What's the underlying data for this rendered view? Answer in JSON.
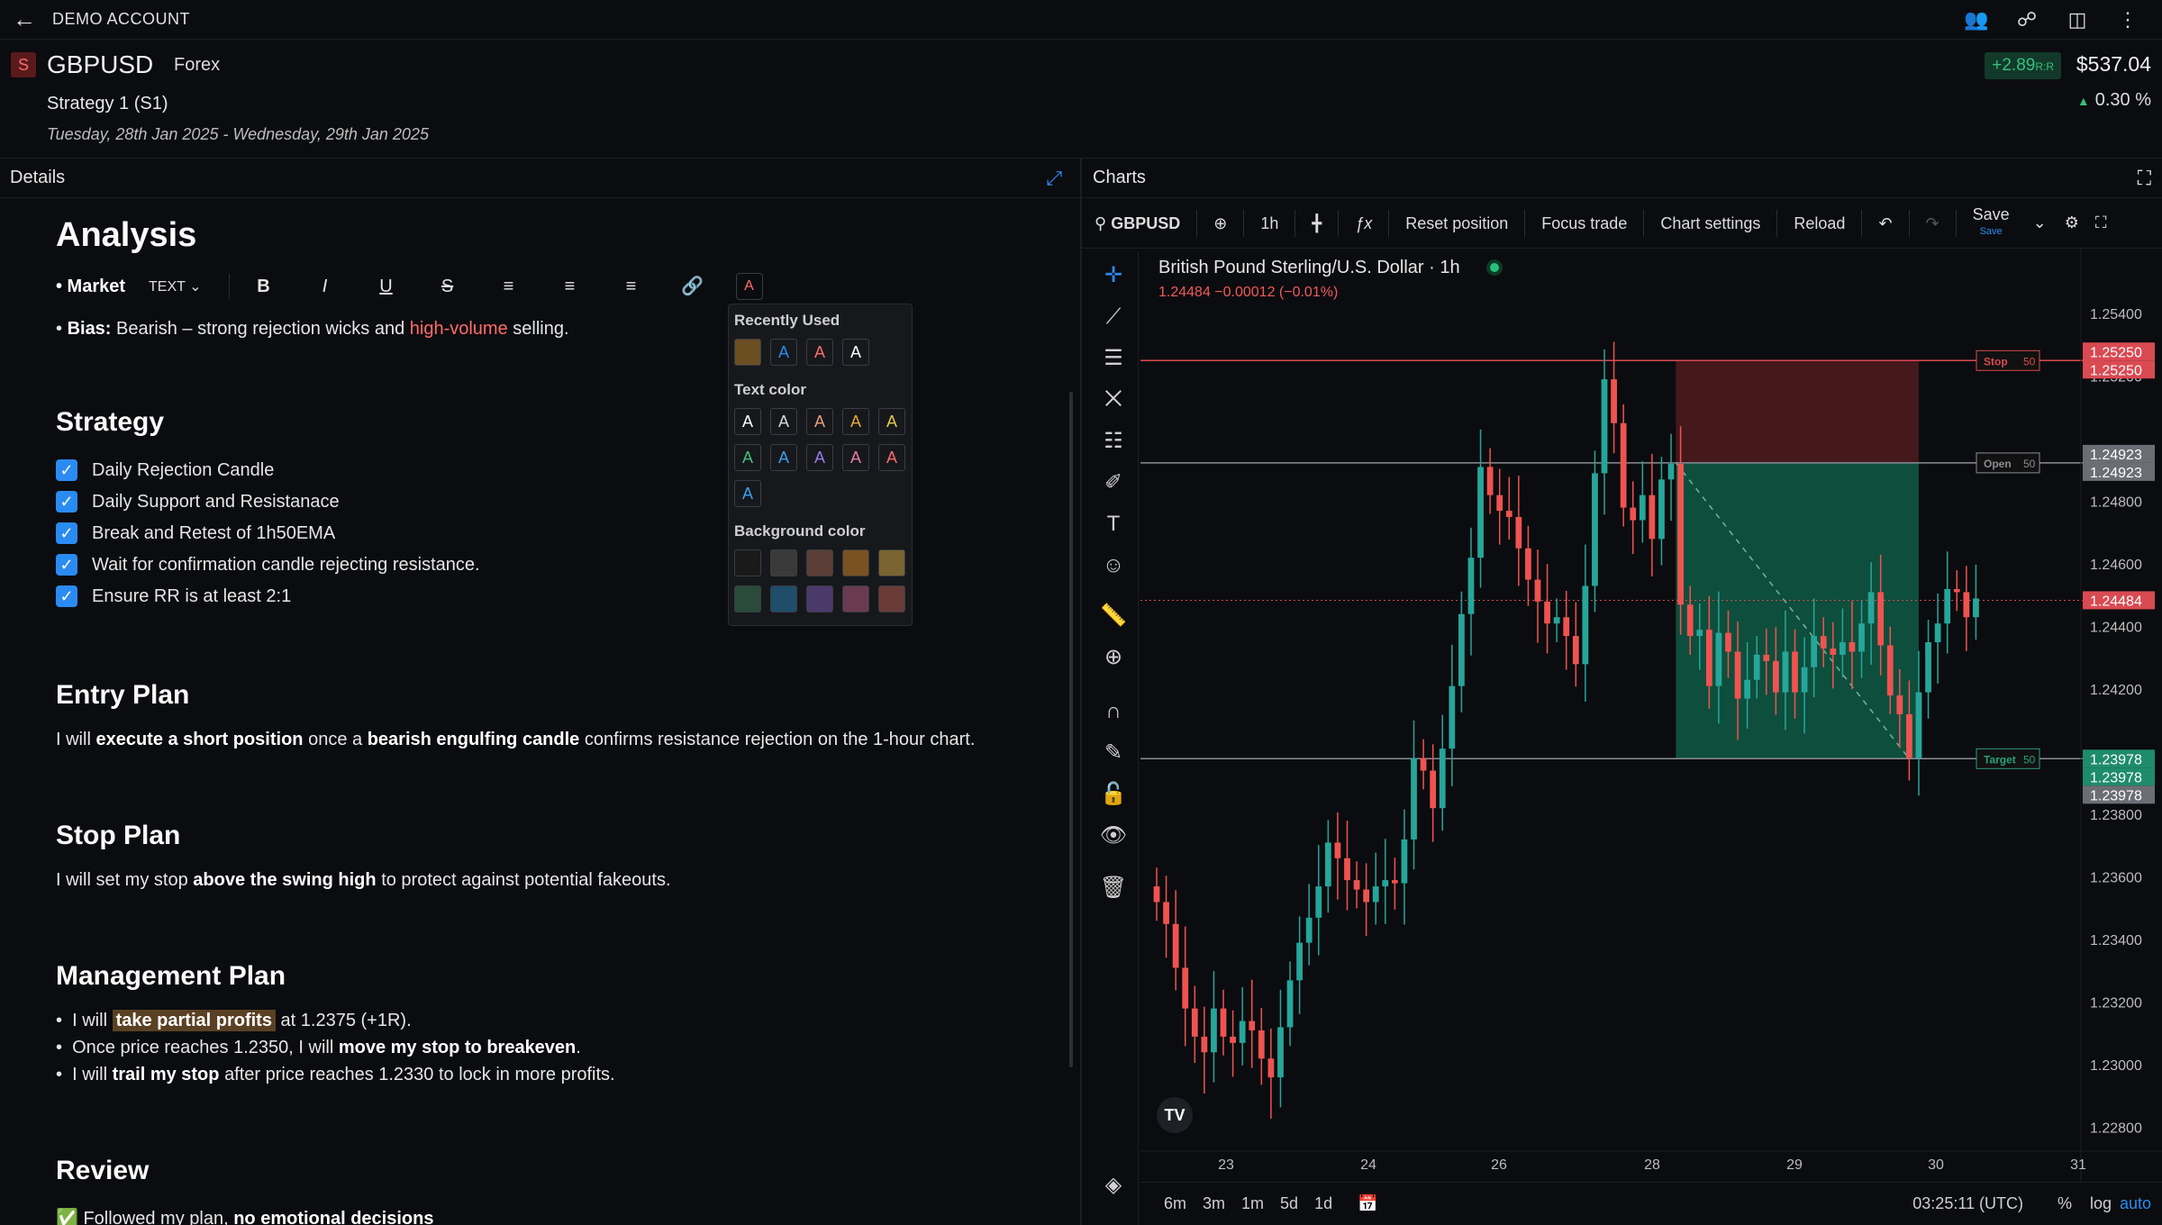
{
  "topbar": {
    "account": "DEMO ACCOUNT"
  },
  "header": {
    "symbol_badge": "S",
    "symbol": "GBPUSD",
    "market": "Forex",
    "strategy": "Strategy 1 (S1)",
    "dates": "Tuesday, 28th Jan 2025 - Wednesday, 29th Jan 2025",
    "rr": "+2.89",
    "rr_unit": "R:R",
    "pnl": "$537.04",
    "pnl_pct": "0.30 %"
  },
  "details": {
    "title": "Details",
    "doc_title": "Analysis",
    "toolbar": {
      "market_label": "• Market",
      "text_style": "TEXT",
      "bold": "B",
      "italic": "I",
      "underline": "U",
      "strike": "S",
      "color": "A"
    },
    "bias_label": "Bias:",
    "bias_text": "Bearish – strong rejection wicks and",
    "bias_red": "high-volume",
    "bias_tail": "selling.",
    "strategy_title": "Strategy",
    "checklist": [
      "Daily Rejection Candle",
      "Daily Support and Resistanace",
      "Break and Retest of 1h50EMA",
      "Wait for confirmation candle rejecting resistance.",
      "Ensure RR is at least 2:1"
    ],
    "entry_title": "Entry Plan",
    "entry_1": "I will",
    "entry_2": "execute a short position",
    "entry_3": "once a",
    "entry_4": "bearish engulfing candle",
    "entry_5": "confirms resistance rejection on the 1-hour chart.",
    "stop_title": "Stop Plan",
    "stop_1": "I will set my stop",
    "stop_2": "above the swing high",
    "stop_3": "to protect against potential fakeouts.",
    "mgmt_title": "Management Plan",
    "mgmt_a1": "I will",
    "mgmt_a2": "take partial profits",
    "mgmt_a3": "at 1.2375 (+1R).",
    "mgmt_b1": "Once price reaches 1.2350, I will",
    "mgmt_b2": "move my stop to breakeven",
    "mgmt_b3": ".",
    "mgmt_c1": "I will",
    "mgmt_c2": "trail my stop",
    "mgmt_c3": "after price reaches 1.2330 to lock in more profits.",
    "review_title": "Review",
    "review_1": "✅ Followed my plan,",
    "review_2": "no emotional decisions"
  },
  "color_popup": {
    "recent_label": "Recently Used",
    "text_label": "Text color",
    "bg_label": "Background color",
    "glyph": "A",
    "recent": [
      "#6b4e22",
      "#2a8bf2",
      "#ff6b6b",
      "#ffffff"
    ],
    "text_colors": [
      "#ffffff",
      "#d8d8d8",
      "#e6a07a",
      "#e6a73a",
      "#e6c84a",
      "#43c07c",
      "#3aa0f0",
      "#9b7be6",
      "#e67aa8",
      "#ff6b6b",
      "#3aa0f0"
    ],
    "bg_colors": [
      "#1a1a1a",
      "#3a3a3a",
      "#5a3e36",
      "#7a5222",
      "#7a6432",
      "#2a4a3a",
      "#1f4d6a",
      "#4a3a6a",
      "#6a3a52",
      "#6a3a36"
    ]
  },
  "charts": {
    "title": "Charts",
    "search": "GBPUSD",
    "interval": "1h",
    "reset": "Reset position",
    "focus": "Focus trade",
    "settings": "Chart settings",
    "reload": "Reload",
    "save": "Save",
    "save_sub": "Save",
    "legend_title": "British Pound Sterling/U.S. Dollar · 1h",
    "legend_vals": "1.24484  −0.00012 (−0.01%)",
    "stop_label": "Stop",
    "open_label": "Open",
    "target_label": "Target",
    "qty": "50",
    "time": "03:25:11 (UTC)",
    "ranges": [
      "6m",
      "3m",
      "1m",
      "5d",
      "1d"
    ],
    "pct": "%",
    "log": "log",
    "auto": "auto"
  },
  "chart_data": {
    "type": "candlestick",
    "title": "British Pound Sterling/U.S. Dollar · 1h",
    "x_ticks": [
      "23",
      "24",
      "26",
      "28",
      "29",
      "30",
      "31"
    ],
    "y_ticks": [
      "1.25400",
      "1.25200",
      "1.24800",
      "1.24600",
      "1.24400",
      "1.24200",
      "1.23800",
      "1.23600",
      "1.23400",
      "1.23200",
      "1.23000",
      "1.22800"
    ],
    "ylim": [
      1.2273,
      1.2555
    ],
    "levels": {
      "stop": 1.2525,
      "open": 1.24923,
      "last": 1.24484,
      "target": 1.23978
    },
    "price_labels": [
      "1.25250",
      "1.25250",
      "1.24923",
      "1.24923",
      "1.24484",
      "1.23978",
      "1.23978",
      "1.23978"
    ],
    "closes": [
      1.2352,
      1.2345,
      1.2331,
      1.2318,
      1.2309,
      1.2304,
      1.2318,
      1.2309,
      1.2307,
      1.2314,
      1.2311,
      1.2302,
      1.2296,
      1.2312,
      1.2327,
      1.2339,
      1.2347,
      1.2357,
      1.2371,
      1.2366,
      1.2359,
      1.2356,
      1.2352,
      1.2357,
      1.2359,
      1.2358,
      1.2372,
      1.2398,
      1.2394,
      1.2382,
      1.2401,
      1.2421,
      1.2444,
      1.2462,
      1.2491,
      1.2482,
      1.2477,
      1.2475,
      1.2465,
      1.2455,
      1.2448,
      1.2441,
      1.2443,
      1.2437,
      1.2428,
      1.2453,
      1.2489,
      1.2519,
      1.2505,
      1.2478,
      1.2474,
      1.2482,
      1.2468,
      1.2487,
      1.2492,
      1.2447,
      1.2437,
      1.2439,
      1.2421,
      1.2438,
      1.2432,
      1.2417,
      1.2423,
      1.2431,
      1.2429,
      1.2419,
      1.2432,
      1.2419,
      1.2427,
      1.2437,
      1.2433,
      1.2431,
      1.2435,
      1.2432,
      1.2441,
      1.2451,
      1.2434,
      1.2418,
      1.2412,
      1.2398,
      1.2419,
      1.2435,
      1.2441,
      1.2452,
      1.2451,
      1.2443,
      1.2449
    ]
  }
}
